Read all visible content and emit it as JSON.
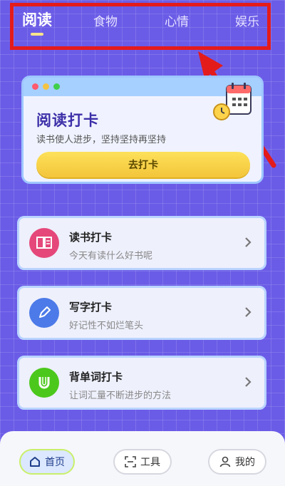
{
  "tabs": [
    "阅读",
    "食物",
    "心情",
    "娱乐"
  ],
  "hero": {
    "title": "阅读打卡",
    "subtitle": "读书使人进步，坚持坚持再坚持",
    "button": "去打卡"
  },
  "cards": [
    {
      "title": "读书打卡",
      "subtitle": "今天有读什么好书呢",
      "icon": "book-icon",
      "color": "#e5477a"
    },
    {
      "title": "写字打卡",
      "subtitle": "好记性不如烂笔头",
      "icon": "pencil-icon",
      "color": "#4c7ae8"
    },
    {
      "title": "背单词打卡",
      "subtitle": "让词汇量不断进步的方法",
      "icon": "u-letter-icon",
      "color": "#4cc81c"
    }
  ],
  "bottom_nav": [
    {
      "label": "首页",
      "icon": "home-icon"
    },
    {
      "label": "工具",
      "icon": "scan-icon"
    },
    {
      "label": "我的",
      "icon": "user-icon"
    }
  ],
  "colors": {
    "background": "#6b5ce7",
    "highlight": "#e41b1b",
    "accent": "#fde15a"
  }
}
